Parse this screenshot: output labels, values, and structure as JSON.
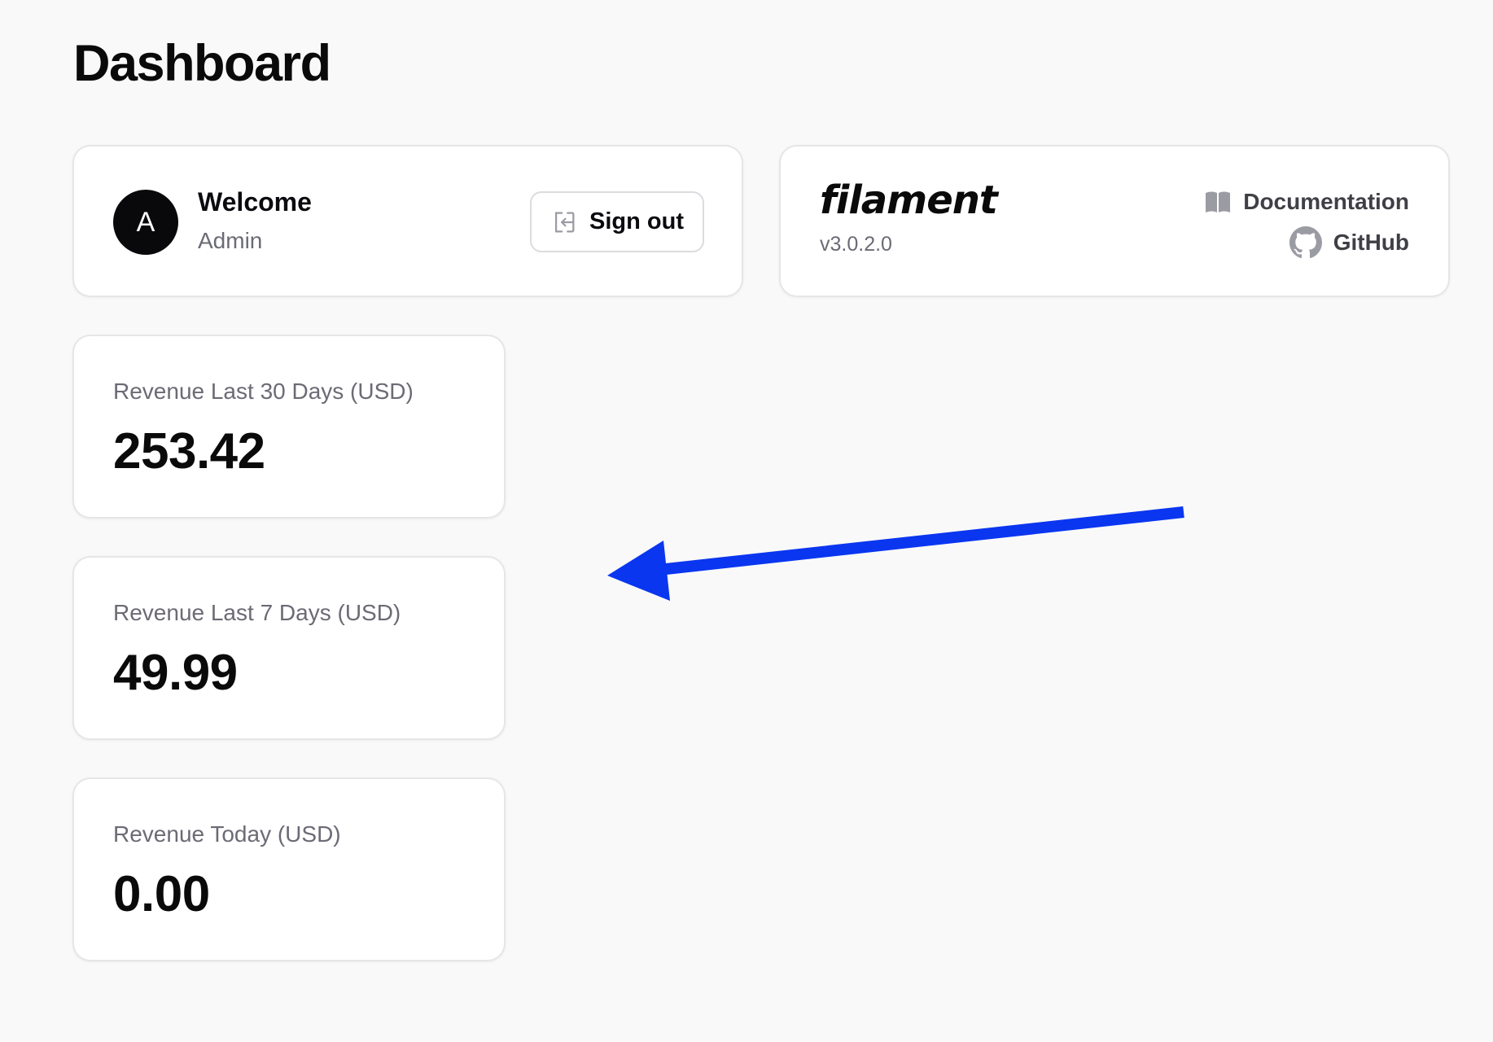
{
  "page": {
    "title": "Dashboard"
  },
  "account_widget": {
    "avatar_initial": "A",
    "greeting": "Welcome",
    "user_name": "Admin",
    "sign_out_label": "Sign out"
  },
  "filament_widget": {
    "logo_text": "filament",
    "version": "v3.0.2.0",
    "links": {
      "documentation": "Documentation",
      "github": "GitHub"
    }
  },
  "stats": [
    {
      "label": "Revenue Last 30 Days (USD)",
      "value": "253.42"
    },
    {
      "label": "Revenue Last 7 Days (USD)",
      "value": "49.99"
    },
    {
      "label": "Revenue Today (USD)",
      "value": "0.00"
    }
  ],
  "colors": {
    "background": "#f9f9f9",
    "card": "#ffffff",
    "avatar": "#09090b",
    "muted_text": "#6b6b75",
    "link_text": "#3f3f46",
    "annotation_arrow": "#0a36f0"
  },
  "icons": {
    "sign_out": "arrow-left-on-rectangle-icon",
    "documentation": "book-open-icon",
    "github": "github-icon"
  }
}
